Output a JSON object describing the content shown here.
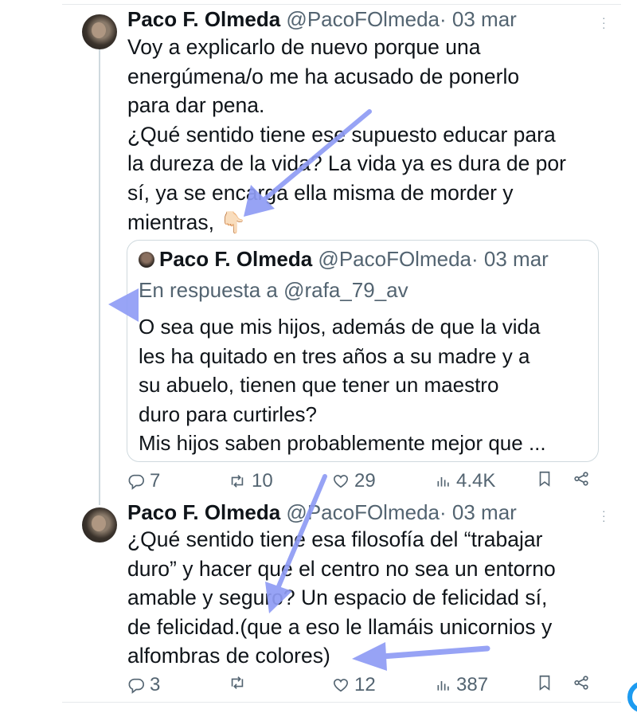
{
  "tweets": [
    {
      "name": "Paco F. Olmeda",
      "handle": "@PacoFOlmeda",
      "sep": "·",
      "date": "03 mar",
      "lines": [
        "Voy a explicarlo de nuevo porque una",
        "energúmena/o me ha acusado de ponerlo",
        "para dar pena.",
        "¿Qué sentido tiene ese supuesto educar para",
        "la dureza de la vida? La vida ya es dura de por",
        "sí, ya se encarga ella misma de morder y",
        "mientras, 👇🏻"
      ],
      "quote": {
        "name": "Paco F. Olmeda",
        "handle": "@PacoFOlmeda",
        "sep": "·",
        "date": "03 mar",
        "reply_to": "En respuesta a @rafa_79_av",
        "lines": [
          "O sea que mis hijos, además de que la vida",
          "les ha quitado en tres años a su madre y a",
          "su abuelo, tienen que tener un maestro",
          "duro para curtirles?",
          "Mis hijos saben probablemente mejor que ..."
        ]
      },
      "stats": {
        "replies": "7",
        "retweets": "10",
        "likes": "29",
        "views": "4.4K"
      }
    },
    {
      "name": "Paco F. Olmeda",
      "handle": "@PacoFOlmeda",
      "sep": "·",
      "date": "03 mar",
      "lines": [
        "¿Qué sentido tiene esa filosofía del “trabajar",
        "duro” y hacer que el centro no sea un entorno",
        "amable y seguro? Un espacio de felicidad sí,",
        "de felicidad.(que a eso le llamáis unicornios y",
        "alfombras de colores)"
      ],
      "stats": {
        "replies": "3",
        "retweets": "",
        "likes": "12",
        "views": "387"
      }
    }
  ],
  "icons": {
    "reply": "reply-icon",
    "retweet": "retweet-icon",
    "like": "heart-icon",
    "views": "views-icon",
    "bookmark": "bookmark-icon",
    "share": "share-icon",
    "more": "more-icon"
  },
  "colors": {
    "text": "#0f1419",
    "secondary": "#536471",
    "border": "#cfd9de",
    "annotation_arrow": "#8f9cf5",
    "accent": "#1d9bf0"
  }
}
